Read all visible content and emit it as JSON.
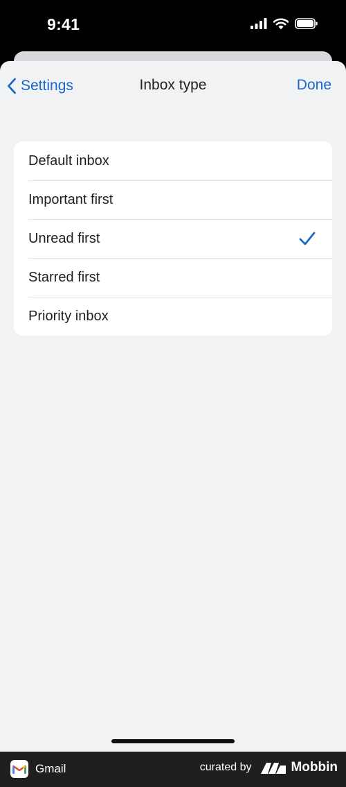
{
  "status_bar": {
    "time": "9:41",
    "icons": [
      "signal-icon",
      "wifi-icon",
      "battery-icon"
    ]
  },
  "nav": {
    "back_label": "Settings",
    "title": "Inbox type",
    "done_label": "Done"
  },
  "inbox_types": {
    "selected": "Unread first",
    "options": [
      {
        "label": "Default inbox",
        "selected": false
      },
      {
        "label": "Important first",
        "selected": false
      },
      {
        "label": "Unread first",
        "selected": true
      },
      {
        "label": "Starred first",
        "selected": false
      },
      {
        "label": "Priority inbox",
        "selected": false
      }
    ]
  },
  "footer": {
    "app_name": "Gmail",
    "curated_by": "curated by",
    "brand": "Mobbin"
  },
  "colors": {
    "accent": "#1a66c9",
    "background": "#f1f2f4",
    "card": "#ffffff",
    "text": "#1f1f1f"
  }
}
